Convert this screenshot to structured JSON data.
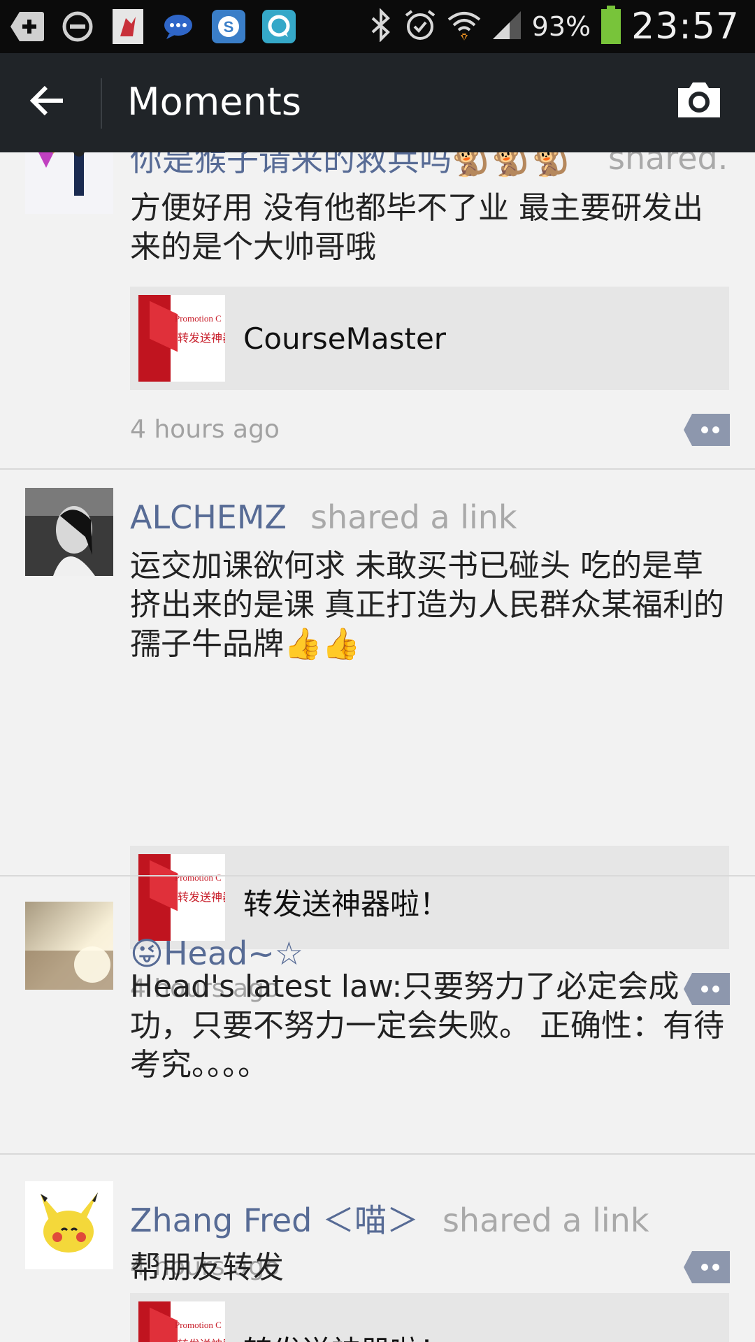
{
  "status_bar": {
    "battery_percent": "93%",
    "time": "23:57",
    "left_icons": [
      "add-icon",
      "do-not-disturb-icon",
      "app-icon",
      "chat-bubble-icon",
      "skype-icon",
      "messenger-icon"
    ],
    "right_icons": [
      "bluetooth-icon",
      "alarm-icon",
      "wifi-icon",
      "signal-icon",
      "battery-icon"
    ]
  },
  "header": {
    "title": "Moments",
    "back_icon": "back-arrow-icon",
    "camera_icon": "camera-icon"
  },
  "posts": [
    {
      "name": "你是猴子请来的救兵吗🐒🐒🐒",
      "action": "shared...",
      "text": "方便好用 没有他都毕不了业 最主要研发出来的是个大帅哥哦",
      "link_title": "CourseMaster",
      "time": "4 hours ago"
    },
    {
      "name": "ALCHEMZ",
      "action": "shared a link",
      "text": "运交加课欲何求  未敢买书已碰头 吃的是草挤出来的是课 真正打造为人民群众某福利的孺子牛品牌👍👍",
      "link_title": "转发送神器啦！",
      "time": "4 hours ago"
    },
    {
      "name": "😜Head~☆",
      "action": "",
      "text": "Head's latest law:只要努力了必定会成功，只要不努力一定会失败。   正确性：有待考究。。。。",
      "time": "4 hours ago"
    },
    {
      "name": "Zhang Fred ＜喵＞",
      "action": "shared a link",
      "text": "帮朋友转发",
      "link_title": "转发送神器啦！"
    }
  ],
  "thumb": {
    "line1": "Promotion C",
    "line2": "转发送神器"
  },
  "colors": {
    "name_link": "#576b95",
    "title_bar": "#202428",
    "status_bar": "#0b0b0b",
    "background": "#f2f2f2",
    "comment_button": "#8d97ad",
    "battery": "#78c43a"
  }
}
